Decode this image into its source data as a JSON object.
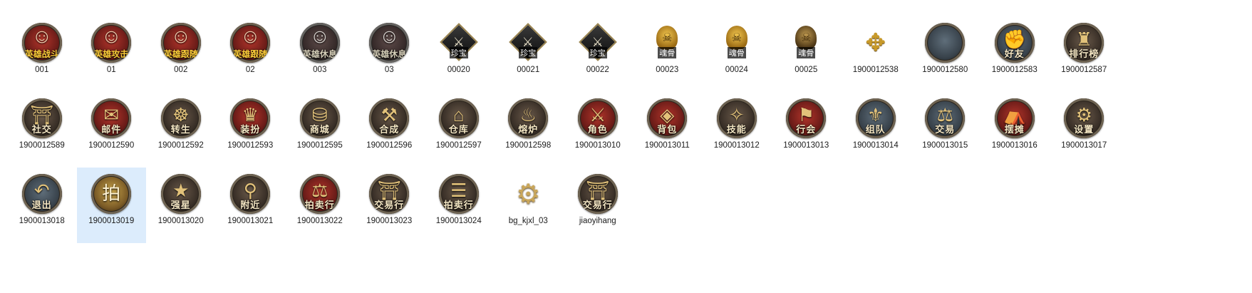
{
  "window": {
    "view": "large-icons",
    "selected": "1900013019"
  },
  "rows": [
    [
      {
        "name": "001",
        "kind": "portrait",
        "label": "英雄战斗",
        "icon": "hero-portrait-icon",
        "tint": "normal"
      },
      {
        "name": "01",
        "kind": "portrait",
        "label": "英雄攻击",
        "icon": "hero-portrait-icon",
        "tint": "normal"
      },
      {
        "name": "002",
        "kind": "portrait",
        "label": "英雄跟随",
        "icon": "hero-portrait-icon",
        "tint": "normal"
      },
      {
        "name": "02",
        "kind": "portrait",
        "label": "英雄跟随",
        "icon": "hero-portrait-icon",
        "tint": "normal"
      },
      {
        "name": "003",
        "kind": "portrait",
        "label": "英雄休息",
        "icon": "hero-portrait-icon",
        "tint": "gray"
      },
      {
        "name": "03",
        "kind": "portrait",
        "label": "英雄休息",
        "icon": "hero-portrait-icon",
        "tint": "gray"
      },
      {
        "name": "00020",
        "kind": "diamond",
        "label": "珍宝",
        "icon": "treasure-icon"
      },
      {
        "name": "00021",
        "kind": "diamond",
        "label": "珍宝",
        "icon": "treasure-icon"
      },
      {
        "name": "00022",
        "kind": "diamond",
        "label": "珍宝",
        "icon": "treasure-icon"
      },
      {
        "name": "00023",
        "kind": "skull",
        "label": "魂骨",
        "icon": "skull-icon",
        "tint": "gold"
      },
      {
        "name": "00024",
        "kind": "skull",
        "label": "魂骨",
        "icon": "skull-icon",
        "tint": "gold"
      },
      {
        "name": "00025",
        "kind": "skull",
        "label": "魂骨",
        "icon": "skull-icon",
        "tint": "dark"
      },
      {
        "name": "1900012538",
        "kind": "arrows",
        "label": "",
        "icon": "move-arrows-icon"
      },
      {
        "name": "1900012580",
        "kind": "medal",
        "label": "",
        "icon": "blank-medallion-icon",
        "bg": "steel"
      },
      {
        "name": "1900012583",
        "kind": "medal",
        "label": "好友",
        "icon": "friends-icon",
        "bg": "steel"
      },
      {
        "name": "1900012587",
        "kind": "medal",
        "label": "排行榜",
        "icon": "ranking-icon",
        "bg": "dark"
      }
    ],
    [
      {
        "name": "1900012589",
        "kind": "medal",
        "label": "社交",
        "icon": "social-icon",
        "bg": "dark"
      },
      {
        "name": "1900012590",
        "kind": "medal",
        "label": "邮件",
        "icon": "mail-icon",
        "bg": "red"
      },
      {
        "name": "1900012592",
        "kind": "medal",
        "label": "转生",
        "icon": "rebirth-icon",
        "bg": "dark"
      },
      {
        "name": "1900012593",
        "kind": "medal",
        "label": "装扮",
        "icon": "dress-up-icon",
        "bg": "red"
      },
      {
        "name": "1900012595",
        "kind": "medal",
        "label": "商城",
        "icon": "shop-icon",
        "bg": "dark"
      },
      {
        "name": "1900012596",
        "kind": "medal",
        "label": "合成",
        "icon": "craft-icon",
        "bg": "dark"
      },
      {
        "name": "1900012597",
        "kind": "medal",
        "label": "仓库",
        "icon": "warehouse-icon",
        "bg": "dark"
      },
      {
        "name": "1900012598",
        "kind": "medal",
        "label": "熔炉",
        "icon": "furnace-icon",
        "bg": "dark"
      },
      {
        "name": "1900013010",
        "kind": "medal",
        "label": "角色",
        "icon": "character-icon",
        "bg": "red"
      },
      {
        "name": "1900013011",
        "kind": "medal",
        "label": "背包",
        "icon": "bag-icon",
        "bg": "red"
      },
      {
        "name": "1900013012",
        "kind": "medal",
        "label": "技能",
        "icon": "skill-icon",
        "bg": "dark"
      },
      {
        "name": "1900013013",
        "kind": "medal",
        "label": "行会",
        "icon": "guild-icon",
        "bg": "red"
      },
      {
        "name": "1900013014",
        "kind": "medal",
        "label": "组队",
        "icon": "team-icon",
        "bg": "steel"
      },
      {
        "name": "1900013015",
        "kind": "medal",
        "label": "交易",
        "icon": "trade-icon",
        "bg": "steel"
      },
      {
        "name": "1900013016",
        "kind": "medal",
        "label": "摆摊",
        "icon": "stall-icon",
        "bg": "red"
      },
      {
        "name": "1900013017",
        "kind": "medal",
        "label": "设置",
        "icon": "settings-icon",
        "bg": "dark"
      }
    ],
    [
      {
        "name": "1900013018",
        "kind": "medal",
        "label": "退出",
        "icon": "exit-arrow-icon",
        "bg": "steel"
      },
      {
        "name": "1900013019",
        "kind": "medal",
        "label": "",
        "icon": "auction-glyph-icon",
        "bg": "gold",
        "glyph": "拍"
      },
      {
        "name": "1900013020",
        "kind": "medal",
        "label": "强星",
        "icon": "enhance-star-icon",
        "bg": "dark"
      },
      {
        "name": "1900013021",
        "kind": "medal",
        "label": "附近",
        "icon": "nearby-icon",
        "bg": "dark"
      },
      {
        "name": "1900013022",
        "kind": "medal",
        "label": "拍卖行",
        "icon": "auction-house-icon",
        "bg": "red"
      },
      {
        "name": "1900013023",
        "kind": "medal",
        "label": "交易行",
        "icon": "trading-post-icon",
        "bg": "dark"
      },
      {
        "name": "1900013024",
        "kind": "medal",
        "label": "拍卖行",
        "icon": "auction-book-icon",
        "bg": "dark"
      },
      {
        "name": "bg_kjxl_03",
        "kind": "gear",
        "label": "",
        "icon": "gear-icon"
      },
      {
        "name": "jiaoyihang",
        "kind": "medal",
        "label": "交易行",
        "icon": "trading-post-icon",
        "bg": "dark"
      }
    ]
  ]
}
